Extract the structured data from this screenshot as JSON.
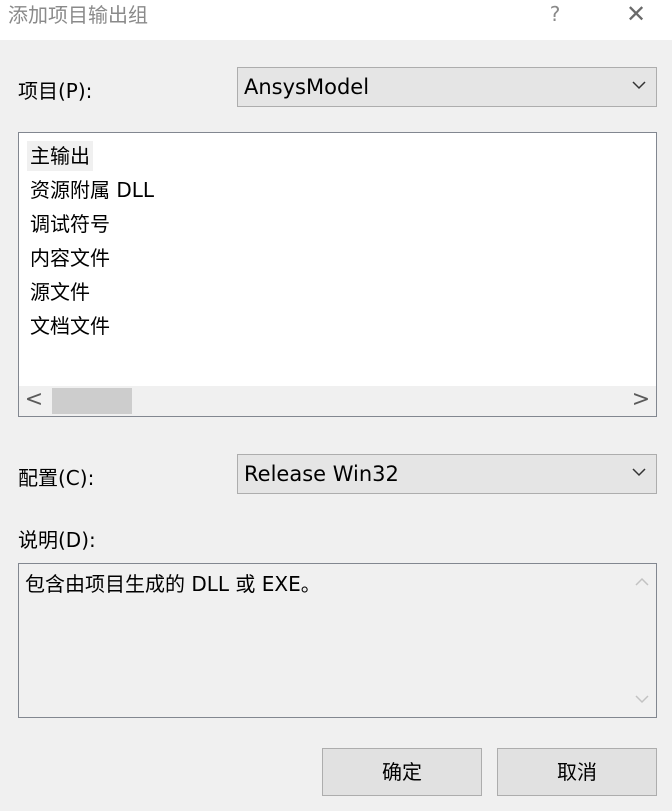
{
  "window": {
    "title": "添加项目输出组",
    "help_label": "?",
    "close_label": "✕"
  },
  "project": {
    "label": "项目(P):",
    "value": "AnsysModel"
  },
  "output_list": {
    "items": [
      {
        "label": "主输出",
        "selected": true
      },
      {
        "label": "资源附属 DLL",
        "selected": false
      },
      {
        "label": "调试符号",
        "selected": false
      },
      {
        "label": "内容文件",
        "selected": false
      },
      {
        "label": "源文件",
        "selected": false
      },
      {
        "label": "文档文件",
        "selected": false
      }
    ],
    "scroll_left": "<",
    "scroll_right": ">"
  },
  "configuration": {
    "label": "配置(C):",
    "value": "Release Win32"
  },
  "description": {
    "label": "说明(D):",
    "text": "包含由项目生成的 DLL 或 EXE。"
  },
  "buttons": {
    "ok": "确定",
    "cancel": "取消"
  },
  "colors": {
    "background": "#f0f0f0",
    "combo_fill": "#e5e5e5",
    "button_fill": "#e1e1e1",
    "border": "#adadad"
  }
}
